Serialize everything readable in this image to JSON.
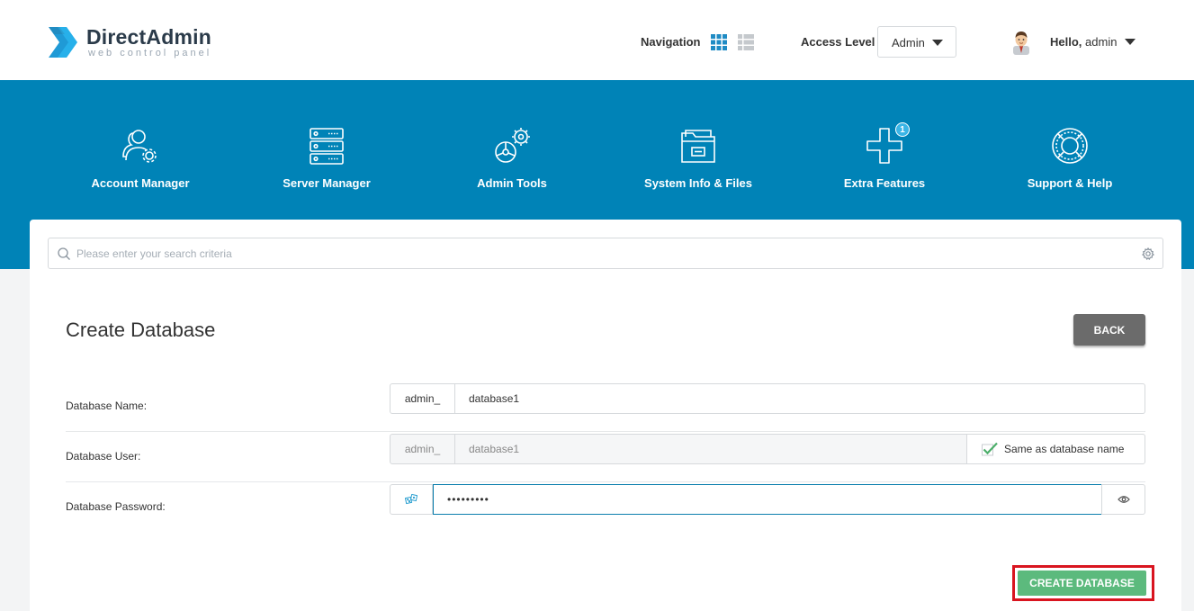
{
  "app": {
    "name": "DirectAdmin",
    "tagline": "web control panel",
    "brand_color": "#0083b7"
  },
  "header": {
    "navigation_label": "Navigation",
    "navigation_modes": [
      "grid-icon",
      "list-icon"
    ],
    "access_level_label": "Access Level",
    "access_level_value": "Admin",
    "greeting": "Hello,",
    "username": "admin"
  },
  "menu": {
    "items": [
      {
        "label": "Account Manager",
        "icon": "account-manager-icon"
      },
      {
        "label": "Server Manager",
        "icon": "server-manager-icon"
      },
      {
        "label": "Admin Tools",
        "icon": "admin-tools-icon"
      },
      {
        "label": "System Info & Files",
        "icon": "system-info-icon"
      },
      {
        "label": "Extra Features",
        "icon": "extra-features-icon",
        "badge": "1"
      },
      {
        "label": "Support & Help",
        "icon": "support-help-icon"
      }
    ]
  },
  "search": {
    "placeholder": "Please enter your search criteria",
    "value": ""
  },
  "page": {
    "title": "Create Database",
    "back_label": "BACK"
  },
  "form": {
    "db_name": {
      "label": "Database Name:",
      "prefix": "admin_",
      "value": "database1"
    },
    "db_user": {
      "label": "Database User:",
      "prefix": "admin_",
      "value": "database1",
      "same_as_label": "Same as database name",
      "same_as_checked": true
    },
    "db_password": {
      "label": "Database Password:",
      "value": "•••••••••"
    }
  },
  "actions": {
    "create_label": "CREATE DATABASE",
    "create_color": "#5cba7d",
    "highlight_color": "#d91520"
  }
}
